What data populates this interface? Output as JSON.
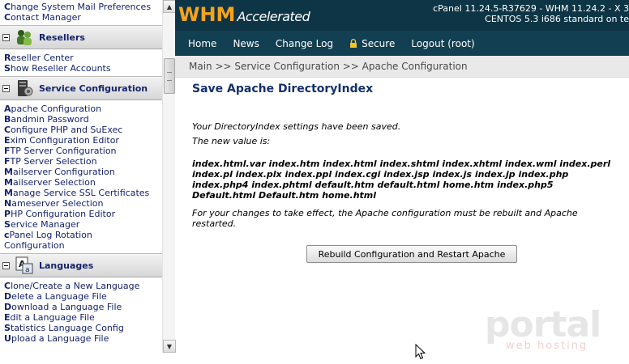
{
  "sidebar": {
    "top_links": [
      {
        "first": "C",
        "rest": "hange System Mail Preferences"
      },
      {
        "first": "C",
        "rest": "ontact Manager"
      }
    ],
    "resellers": {
      "title": "Resellers",
      "links": [
        {
          "first": "R",
          "rest": "eseller Center"
        },
        {
          "first": "S",
          "rest": "how Reseller Accounts"
        }
      ]
    },
    "service_configuration": {
      "title": "Service Configuration",
      "links": [
        {
          "first": "A",
          "rest": "pache Configuration"
        },
        {
          "first": "B",
          "rest": "andmin Password"
        },
        {
          "first": "C",
          "rest": "onfigure PHP and SuExec"
        },
        {
          "first": "E",
          "rest": "xim Configuration Editor"
        },
        {
          "first": "F",
          "rest": "TP Server Configuration"
        },
        {
          "first": "F",
          "rest": "TP Server Selection"
        },
        {
          "first": "M",
          "rest": "ailserver Configuration"
        },
        {
          "first": "M",
          "rest": "ailserver Selection"
        },
        {
          "first": "M",
          "rest": "anage Service SSL Certificates"
        },
        {
          "first": "N",
          "rest": "ameserver Selection"
        },
        {
          "first": "P",
          "rest": "HP Configuration Editor"
        },
        {
          "first": "S",
          "rest": "ervice Manager"
        },
        {
          "first": "c",
          "rest": "Panel Log Rotation"
        },
        {
          "first": "",
          "rest": "Configuration"
        }
      ]
    },
    "languages": {
      "title": "Languages",
      "links": [
        {
          "first": "C",
          "rest": "lone/Create a New Language"
        },
        {
          "first": "D",
          "rest": "elete a Language File"
        },
        {
          "first": "D",
          "rest": "ownload a Language File"
        },
        {
          "first": "E",
          "rest": "dit a Language File"
        },
        {
          "first": "S",
          "rest": "tatistics Language Config"
        },
        {
          "first": "U",
          "rest": "pload a Language File"
        }
      ]
    }
  },
  "header": {
    "logo_whm": "WHM",
    "logo_accelerated": "Accelerated",
    "version_line": "cPanel 11.24.5-R37629 - WHM 11.24.2 - X 3",
    "os_line": "CENTOS 5.3 i686 standard on te"
  },
  "nav": {
    "items": [
      "Home",
      "News",
      "Change Log",
      "Secure",
      "Logout (root)"
    ]
  },
  "breadcrumb": "Main >> Service Configuration >> Apache Configuration",
  "main": {
    "title": "Save Apache DirectoryIndex",
    "saved_message": "Your DirectoryIndex settings have been saved.",
    "new_value_label": "The new value is:",
    "index_lines": [
      "index.html.var index.htm index.html index.shtml index.xhtml index.wml index.perl",
      "index.pl index.plx index.ppl index.cgi index.jsp index.js index.jp index.php",
      "index.php4 index.phtml default.htm default.html home.htm index.php5",
      "Default.html Default.htm home.html"
    ],
    "restart_note": "For your changes to take effect, the Apache configuration must be rebuilt and Apache restarted.",
    "rebuild_button": "Rebuild Configuration and Restart Apache"
  },
  "watermark": {
    "brand": "portal",
    "tagline": "web hosting"
  },
  "colors": {
    "header_bg": "#0e3545",
    "nav_bg": "#123f51",
    "logo_accent": "#f7a21b",
    "link": "#16246b"
  }
}
